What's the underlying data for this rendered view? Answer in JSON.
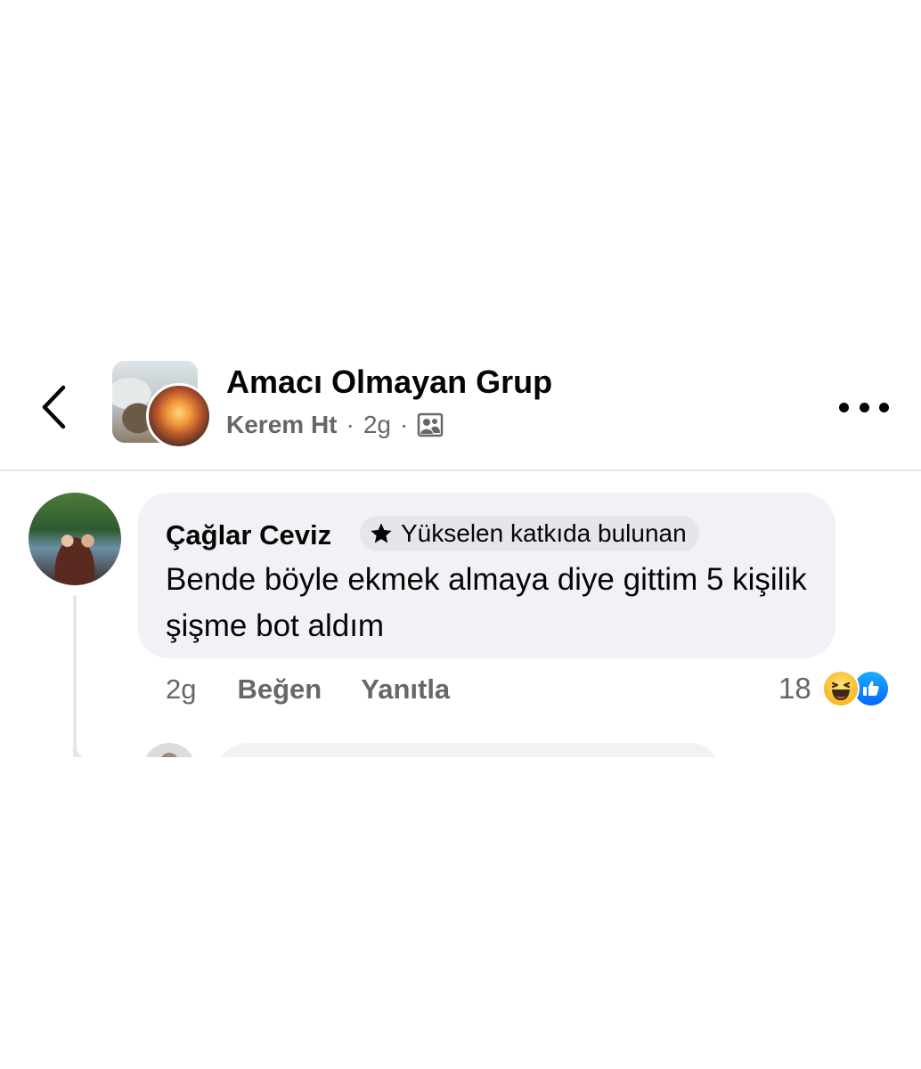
{
  "header": {
    "group_name": "Amacı Olmayan Grup",
    "author": "Kerem Ht",
    "separator": "·",
    "time": "2g",
    "icons": {
      "back": "chevron-left-icon",
      "audience": "group-members-icon",
      "more": "more-options-icon"
    }
  },
  "comment": {
    "author": "Çağlar Ceviz",
    "badge": "Yükselen katkıda bulunan",
    "badge_icon": "star-icon",
    "text": "Bende böyle ekmek almaya diye gittim 5 kişilik şişme bot aldım",
    "time": "2g",
    "like_label": "Beğen",
    "reply_label": "Yanıtla",
    "reaction_count": "18",
    "reactions": [
      "haha-icon",
      "like-icon"
    ]
  },
  "colors": {
    "text_primary": "#050505",
    "text_secondary": "#65676b",
    "bubble_bg": "#f0f2f5",
    "badge_bg": "#e4e6eb",
    "like_blue": "#0866ff",
    "haha_yellow": "#f7b928"
  }
}
